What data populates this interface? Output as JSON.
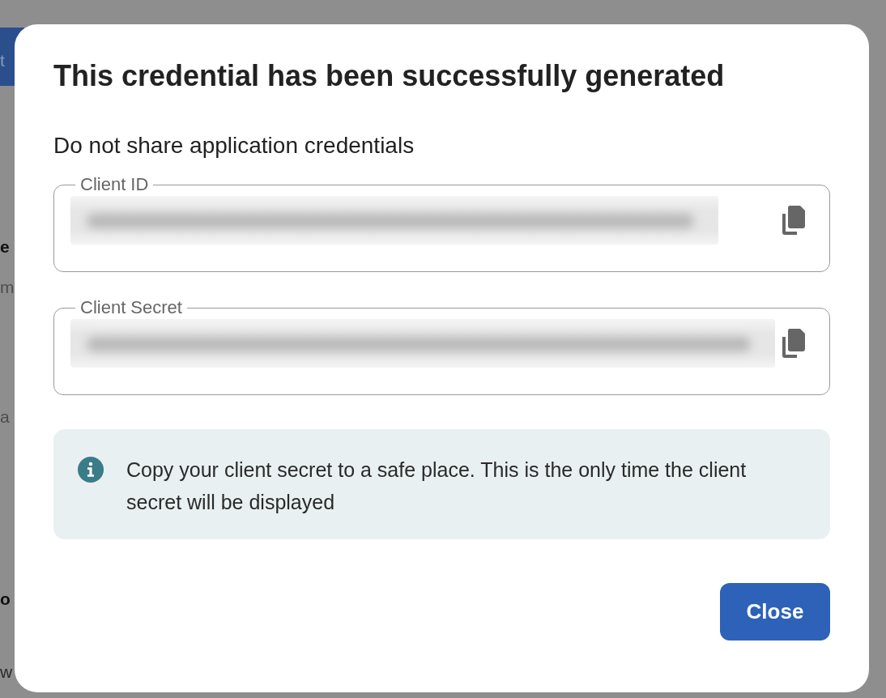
{
  "background_page": {
    "fragments": [
      {
        "text": "t",
        "kind": "banner"
      },
      {
        "text": "e",
        "kind": "heading"
      },
      {
        "text": "m",
        "kind": "muted"
      },
      {
        "text": "a",
        "kind": "muted"
      },
      {
        "text": "o",
        "kind": "heading"
      },
      {
        "text": "w",
        "kind": "body"
      }
    ]
  },
  "dialog": {
    "title": "This credential has been successfully generated",
    "subtitle": "Do not share application credentials",
    "fields": [
      {
        "label": "Client ID"
      },
      {
        "label": "Client Secret"
      }
    ],
    "notice": {
      "text": "Copy your client secret to a safe place. This is the only time the client secret will be displayed"
    },
    "buttons": [
      "Close"
    ]
  }
}
